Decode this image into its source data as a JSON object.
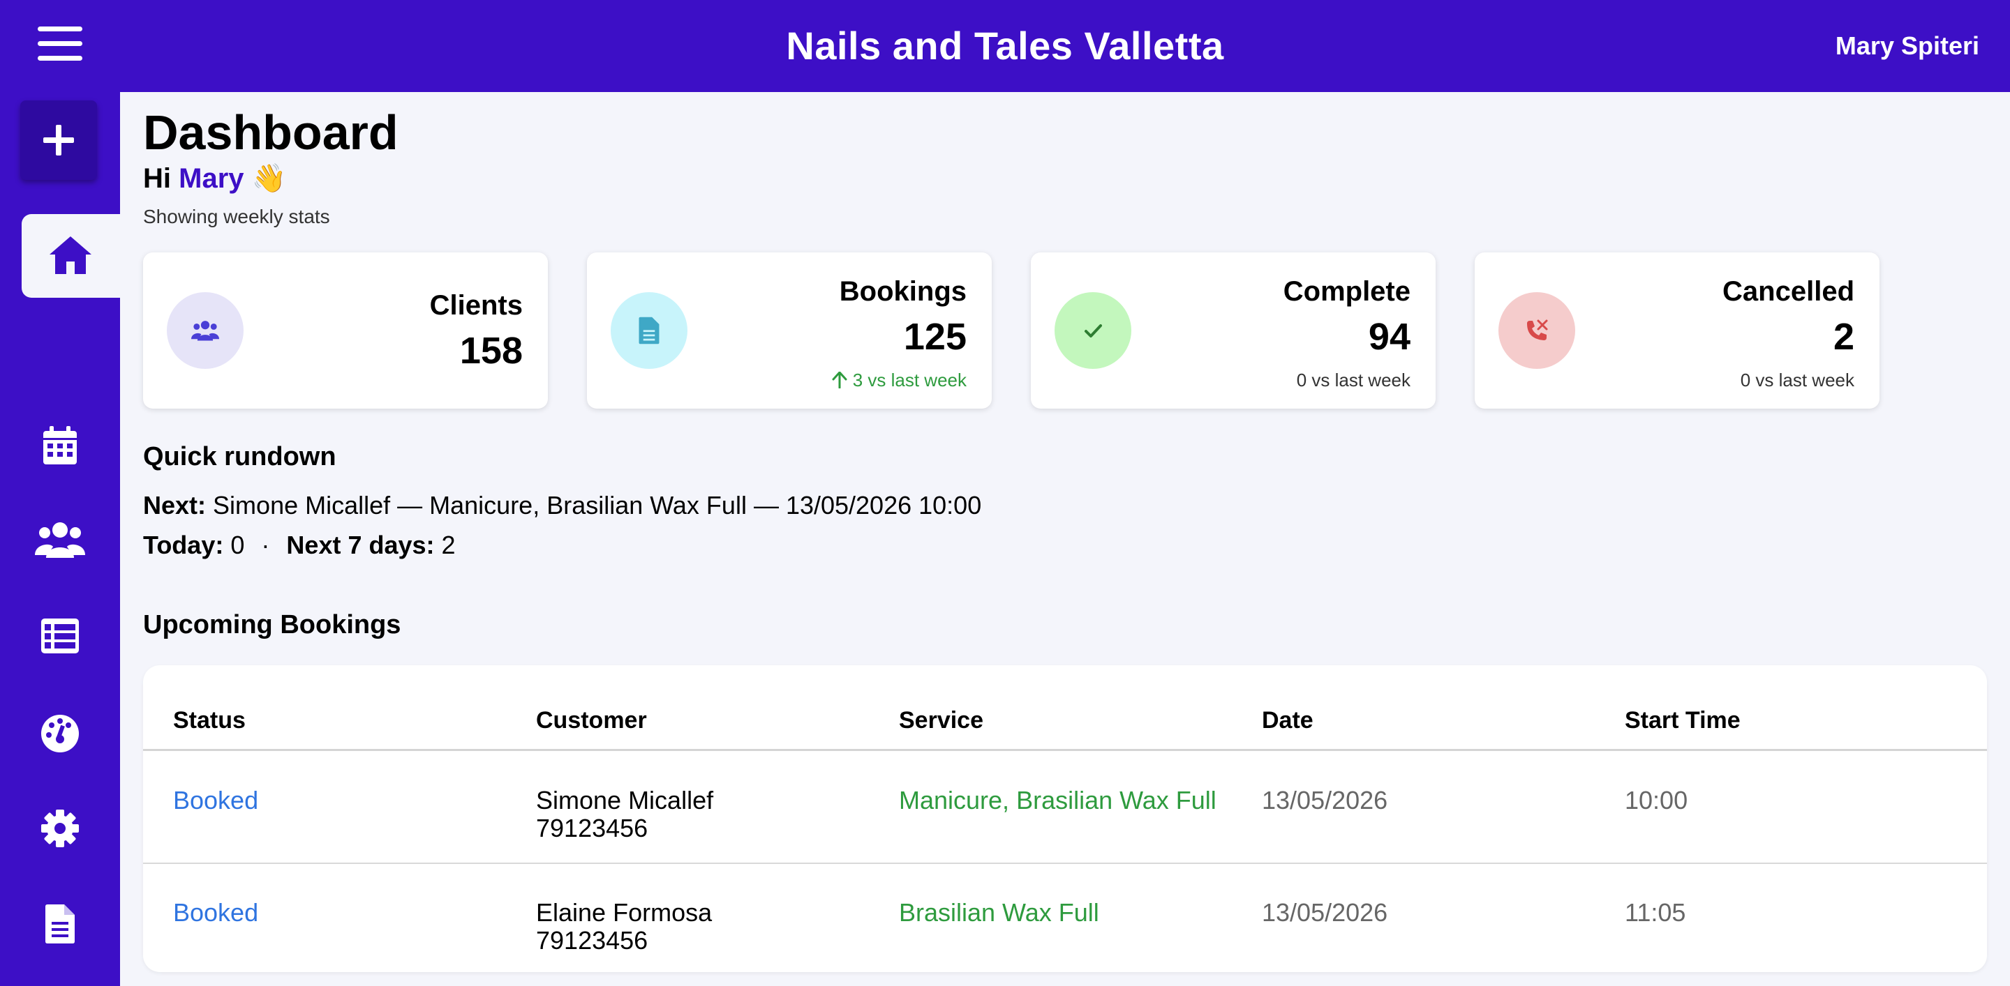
{
  "header": {
    "title": "Nails and Tales Valletta",
    "user": "Mary Spiteri"
  },
  "sidebar": {
    "items": [
      {
        "icon": "home-icon",
        "active": true
      },
      {
        "icon": "calendar-icon"
      },
      {
        "icon": "users-icon"
      },
      {
        "icon": "list-icon"
      },
      {
        "icon": "palette-icon"
      },
      {
        "icon": "gear-icon"
      },
      {
        "icon": "document-icon"
      }
    ]
  },
  "dashboard": {
    "title": "Dashboard",
    "greeting_prefix": "Hi",
    "greeting_name": "Mary",
    "greeting_emoji": "👋",
    "subtitle": "Showing weekly stats"
  },
  "stats": [
    {
      "label": "Clients",
      "value": "158",
      "icon": "users-icon",
      "icon_bg": "#e6e4f8",
      "icon_color": "#4a3fd6"
    },
    {
      "label": "Bookings",
      "value": "125",
      "trend": "3 vs last week",
      "trend_direction": "up",
      "icon": "document-icon",
      "icon_bg": "#c8f4fb",
      "icon_color": "#3fa8c6"
    },
    {
      "label": "Complete",
      "value": "94",
      "trend": "0 vs last week",
      "icon": "check-icon",
      "icon_bg": "#c3f7bd",
      "icon_color": "#2e7d32"
    },
    {
      "label": "Cancelled",
      "value": "2",
      "trend": "0 vs last week",
      "icon": "phone-cancel-icon",
      "icon_bg": "#f5cccc",
      "icon_color": "#d84a4a"
    }
  ],
  "rundown": {
    "title": "Quick rundown",
    "next_label": "Next:",
    "next_value": "Simone Micallef — Manicure, Brasilian Wax Full — 13/05/2026 10:00",
    "today_label": "Today:",
    "today_value": "0",
    "separator": "·",
    "week_label": "Next 7 days:",
    "week_value": "2"
  },
  "upcoming": {
    "title": "Upcoming Bookings",
    "columns": [
      "Status",
      "Customer",
      "Service",
      "Date",
      "Start Time"
    ],
    "rows": [
      {
        "status": "Booked",
        "customer": "Simone Micallef",
        "phone": "79123456",
        "service": "Manicure, Brasilian Wax Full",
        "date": "13/05/2026",
        "time": "10:00"
      },
      {
        "status": "Booked",
        "customer": "Elaine Formosa",
        "phone": "79123456",
        "service": "Brasilian Wax Full",
        "date": "13/05/2026",
        "time": "11:05"
      }
    ]
  },
  "colors": {
    "brand": "#3d0fc6",
    "link": "#2f74e0",
    "service": "#2e9b3e",
    "background": "#f4f5fb"
  }
}
